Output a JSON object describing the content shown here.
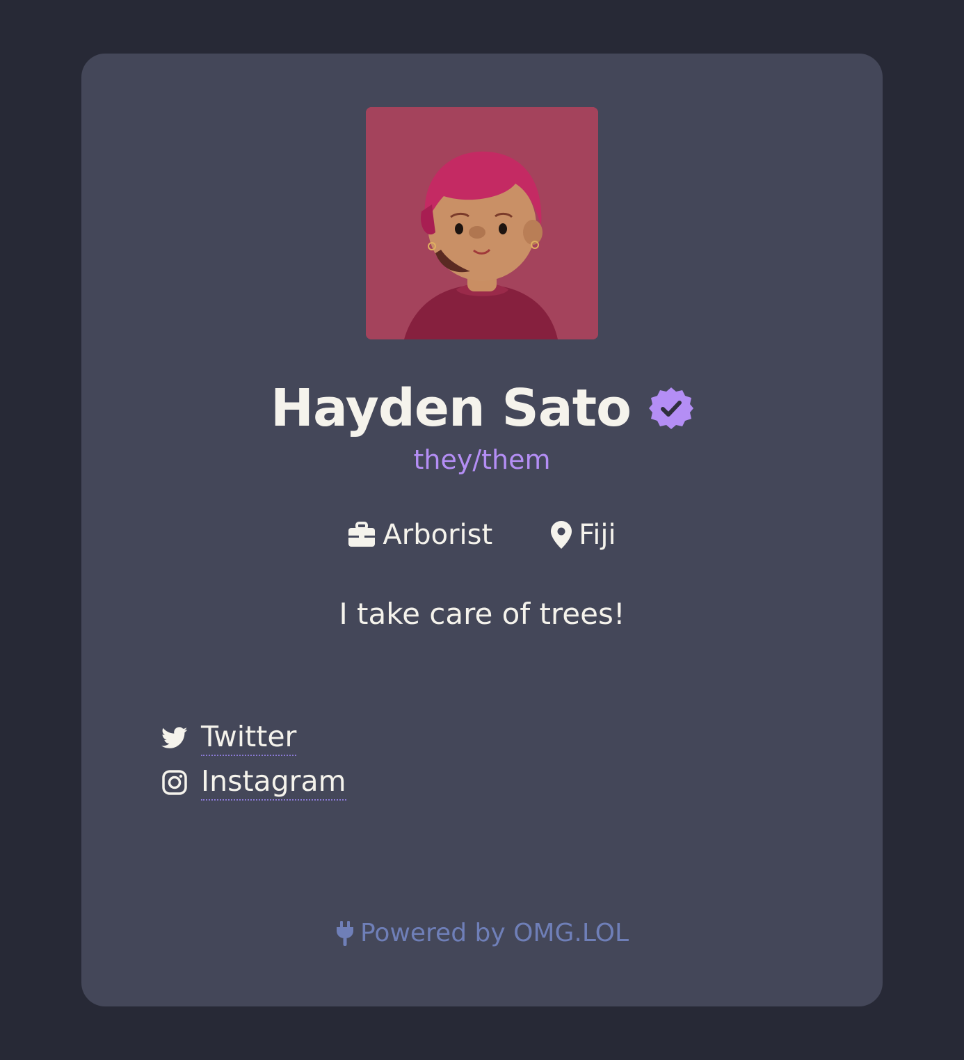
{
  "profile": {
    "name": "Hayden Sato",
    "pronouns": "they/them",
    "occupation": "Arborist",
    "location": "Fiji",
    "bio": "I take care of trees!",
    "avatar_alt": "3D avatar with pink hair",
    "verified": true
  },
  "links": [
    {
      "label": "Twitter",
      "icon": "twitter-icon"
    },
    {
      "label": "Instagram",
      "icon": "instagram-icon"
    }
  ],
  "footer": {
    "text": "Powered by OMG.LOL",
    "icon": "plug-icon"
  },
  "colors": {
    "page_bg": "#272936",
    "card_bg": "#444759",
    "text": "#f5f3ec",
    "accent": "#b48ef5",
    "footer": "#6f7fb8",
    "link_underline": "#8b7ad6",
    "avatar_bg": "#a4435c"
  }
}
